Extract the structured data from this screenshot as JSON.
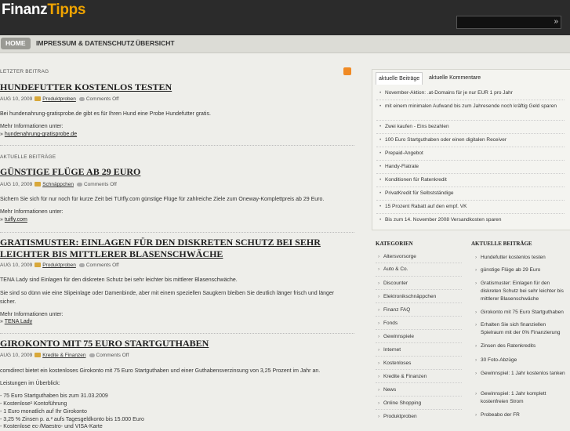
{
  "header": {
    "logo_main": "Finanz",
    "logo_accent": "Tipps",
    "search_button": "»"
  },
  "nav": {
    "items": [
      "HOME",
      "IMPRESSUM & DATENSCHUTZ",
      "ÜBERSICHT"
    ]
  },
  "main": {
    "latest_label": "LETZTER BEITRAG",
    "current_label": "AKTUELLE BEITRÄGE",
    "posts": [
      {
        "title": "HUNDEFUTTER KOSTENLOS TESTEN",
        "date": "AUG 10, 2009",
        "category": "Produktproben",
        "comments": "Comments Off",
        "text": "Bei hundenahrung-gratisprobe.de gibt es für Ihren Hund eine Probe Hundefutter gratis.",
        "more": "Mehr Informationen unter:",
        "link_prefix": "» ",
        "link": "hundenahrung-gratisprobe.de"
      },
      {
        "title": "GÜNSTIGE FLÜGE AB 29 EURO",
        "date": "AUG 10, 2009",
        "category": "Schnäppchen",
        "comments": "Comments Off",
        "text": "Sichern Sie sich für nur noch für kurze Zeit bei TUIfly.com günstige Flüge für zahlreiche Ziele zum Oneway-Komplettpreis ab 29 Euro.",
        "more": "Mehr Informationen unter:",
        "link_prefix": "» ",
        "link": "tuifly.com"
      },
      {
        "title": "GRATISMUSTER: EINLAGEN FÜR DEN DISKRETEN SCHUTZ BEI SEHR LEICHTER BIS MITTLERER BLASENSCHWÄCHE",
        "date": "AUG 10, 2009",
        "category": "Produktproben",
        "comments": "Comments Off",
        "text": "TENA Lady sind Einlagen für den diskreten Schutz bei sehr leichter bis mittlerer Blasenschwäche.",
        "text2": "Sie sind so dünn wie eine Slipeinlage oder Damenbinde, aber mit einem speziellen Saugkern bleiben Sie deutlich länger frisch und länger sicher.",
        "more": "Mehr Informationen unter:",
        "link_prefix": "» ",
        "link": "TENA Lady"
      },
      {
        "title": "GIROKONTO MIT 75 EURO STARTGUTHABEN",
        "date": "AUG 10, 2009",
        "category": "Kredite & Finanzen",
        "comments": "Comments Off",
        "text": "comdirect bietet ein kostenloses Girokonto mit 75 Euro Startguthaben und einer Guthabensverzinsung von 3,25 Prozent im Jahr an.",
        "overview": "Leistungen im Überblick:",
        "bullets": [
          "- 75 Euro Startguthaben bis zum 31.03.2009",
          "- Kostenlose¹ Kontoführung",
          "- 1 Euro monatlich auf Ihr Girokonto",
          "- 3,25 % Zinsen p. a.² aufs Tagesgeldkonto bis 15.000 Euro",
          "- Kostenlose ec-/Maestro- und VISA-Karte"
        ]
      }
    ]
  },
  "sidebar": {
    "tabs": [
      "aktuelle Beiträge",
      "aktuelle Kommentare"
    ],
    "tab_items": [
      "November-Aktion: .at-Domains für je nur EUR 1 pro Jahr",
      "mit einem minimalen Aufwand bis zum Jahresende noch kräftig Geld sparen",
      "Zwei kaufen - Eins bezahlen",
      "100 Euro Startguthaben oder einen digitalen Receiver",
      "Prepaid-Angebot",
      "Handy-Flatrate",
      "Konditionen für Ratenkredit",
      "PrivatKredit für Selbstständige",
      "15 Prozent Rabatt auf den empf. VK",
      "Bis zum 14. November 2008 Versandkosten sparen"
    ],
    "categories_title": "KATEGORIEN",
    "categories": [
      "Altersvorsorge",
      "Auto & Co.",
      "Discounter",
      "Elektronikschnäppchen",
      "Finanz FAQ",
      "Fonds",
      "Gewinnspiele",
      "Internet",
      "Kostenloses",
      "Kredite & Finanzen",
      "News",
      "Online Shopping",
      "Produktproben"
    ],
    "recent_title": "AKTUELLE BEITRÄGE",
    "recent": [
      "Hundefutter kostenlos testen",
      "günstige Flüge ab 29 Euro",
      "Gratismuster: Einlagen für den diskreten Schutz bei sehr leichter bis mittlerer Blasenschwäche",
      "Girokonto mit 75 Euro Startguthaben",
      "Erhalten Sie sich finanziellen Spielraum mit der 0% Finanzierung",
      "Zinsen des Ratenkredits",
      "30 Foto-Abzüge",
      "Gewinnspiel: 1 Jahr kostenlos tanken",
      "Gewinnspiel: 1 Jahr komplett kostenfreien Strom",
      "Probeabo der FR"
    ]
  }
}
